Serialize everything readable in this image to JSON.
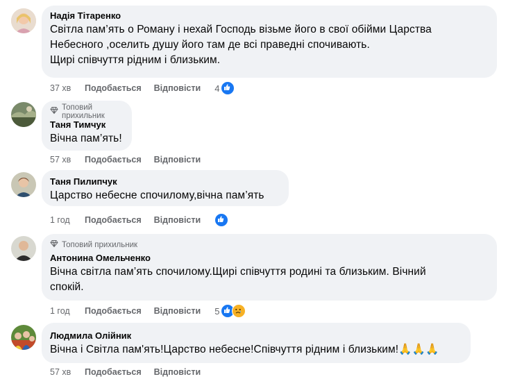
{
  "comments": [
    {
      "author": "Надія Тітаренко",
      "badge": "",
      "text": [
        "Світла пам’ять о Роману і нехай Господь візьме його в свої обійми Царства",
        "Небесного ,оселить душу його там де всі праведні спочивають.",
        "Щирі співчуття рідним і близьким."
      ],
      "time": "37 хв",
      "reaction_count": "4",
      "reactions": [
        "like"
      ]
    },
    {
      "author": "Таня Тимчук",
      "badge": "Топовий прихильник",
      "text": [
        "Вічна пам’ять!"
      ],
      "time": "57 хв",
      "reaction_count": "",
      "reactions": []
    },
    {
      "author": "Таня Пилипчук",
      "badge": "",
      "text": [
        "Царство небесне спочилому,вічна пам’ять"
      ],
      "time": "1 год",
      "reaction_count": "",
      "reactions": [
        "like"
      ]
    },
    {
      "author": "Антонина Омельченко",
      "badge": "Топовий прихильник",
      "text": [
        "Вічна світла пам’ять спочилому.Щирі співчуття родині та близьким. Вічний",
        "спокій."
      ],
      "time": "1 год",
      "reaction_count": "5",
      "reactions": [
        "like",
        "sad"
      ]
    },
    {
      "author": "Людмила Олійник",
      "badge": "",
      "text": [
        "Вічна і Світла пам'ять!Царство небесне!Співчуття рідним і близьким!🙏🙏🙏"
      ],
      "time": "57 хв",
      "reaction_count": "",
      "reactions": []
    }
  ],
  "labels": {
    "like": "Подобається",
    "reply": "Відповісти"
  },
  "colors": {
    "bubble": "#f0f2f5",
    "like_blue": "#1877f2",
    "meta_gray": "#65676b",
    "sad_yellow": "#f7b125"
  }
}
